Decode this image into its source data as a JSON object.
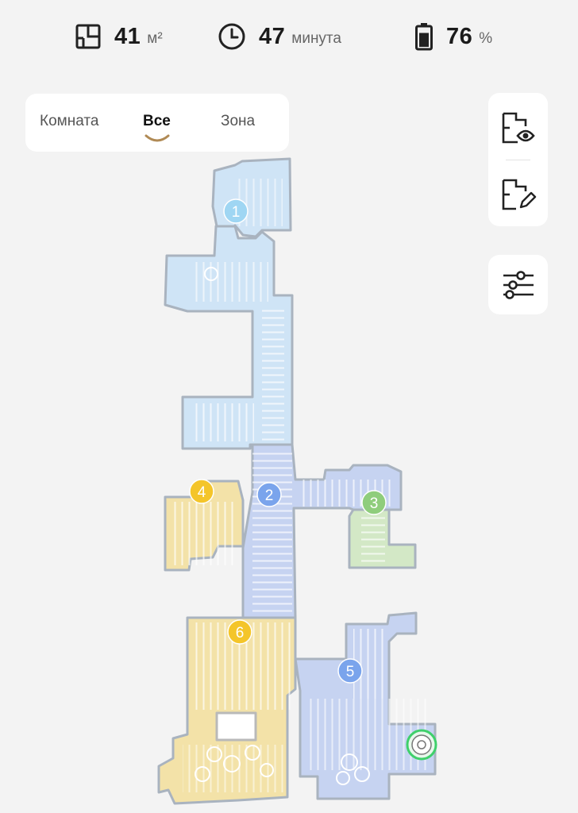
{
  "status": {
    "area": {
      "value": "41",
      "unit": "м²",
      "icon": "floorplan-icon"
    },
    "time": {
      "value": "47",
      "unit": "минута",
      "icon": "clock-icon"
    },
    "battery": {
      "value": "76",
      "unit": "%",
      "icon": "battery-icon",
      "level": 0.76
    }
  },
  "tabs": [
    {
      "label": "Комната",
      "active": false
    },
    {
      "label": "Все",
      "active": true
    },
    {
      "label": "Зона",
      "active": false
    }
  ],
  "side_buttons": [
    "map-view-icon",
    "map-edit-icon",
    "settings-sliders-icon"
  ],
  "rooms": [
    {
      "label": "1",
      "color": "#9fd6f3"
    },
    {
      "label": "2",
      "color": "#7aa4ec"
    },
    {
      "label": "3",
      "color": "#8fcd7c"
    },
    {
      "label": "4",
      "color": "#f4c52a"
    },
    {
      "label": "5",
      "color": "#7aa4ec"
    },
    {
      "label": "6",
      "color": "#f4c52a"
    }
  ],
  "colors": {
    "background": "#f3f3f3",
    "room_light_blue": "#cfe4f6",
    "room_blue": "#c6d3f1",
    "room_yellow": "#f3e2a8",
    "room_green": "#d3e8c6",
    "wall": "#a9b3bf",
    "robot_ring": "#3fd06b"
  }
}
